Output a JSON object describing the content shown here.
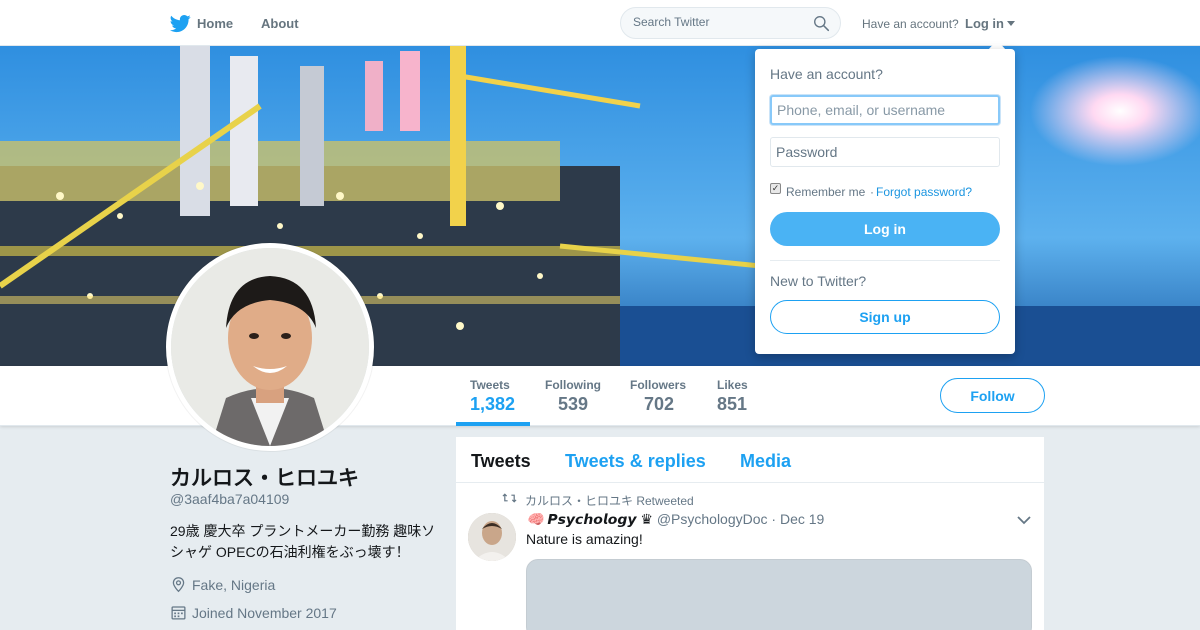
{
  "nav": {
    "home_label": "Home",
    "about_label": "About",
    "search_placeholder": "Search Twitter",
    "have_account": "Have an account?",
    "login_label": "Log in"
  },
  "profile": {
    "name": "カルロス・ヒロユキ",
    "handle": "@3aaf4ba7a04109",
    "bio": "29歳 慶大卒 プラントメーカー勤務 趣味ソシャゲ OPECの石油利権をぶっ壊す！",
    "location": "Fake, Nigeria",
    "joined": "Joined November 2017"
  },
  "stats": [
    {
      "label": "Tweets",
      "value": "1,382",
      "active": true
    },
    {
      "label": "Following",
      "value": "539"
    },
    {
      "label": "Followers",
      "value": "702"
    },
    {
      "label": "Likes",
      "value": "851"
    }
  ],
  "follow_label": "Follow",
  "timeline": {
    "tabs": [
      {
        "label": "Tweets",
        "active": true
      },
      {
        "label": "Tweets & replies"
      },
      {
        "label": "Media"
      }
    ],
    "tweet": {
      "retweet_context": "カルロス・ヒロユキ Retweeted",
      "author_name": "🧠 𝙋𝙨𝙮𝙘𝙝𝙤𝙡𝙤𝙜𝙮 ♛",
      "author_handle": "@PsychologyDoc",
      "date": "· Dec 19",
      "text": "Nature is amazing!"
    }
  },
  "login_dropdown": {
    "title": "Have an account?",
    "username_placeholder": "Phone, email, or username",
    "password_placeholder": "Password",
    "remember_label": "Remember me",
    "separator": "·",
    "forgot_label": "Forgot password?",
    "login_button": "Log in",
    "new_to_twitter": "New to Twitter?",
    "signup_button": "Sign up"
  },
  "colors": {
    "accent": "#1da1f2",
    "background": "#e6ecf0",
    "muted": "#657786"
  }
}
